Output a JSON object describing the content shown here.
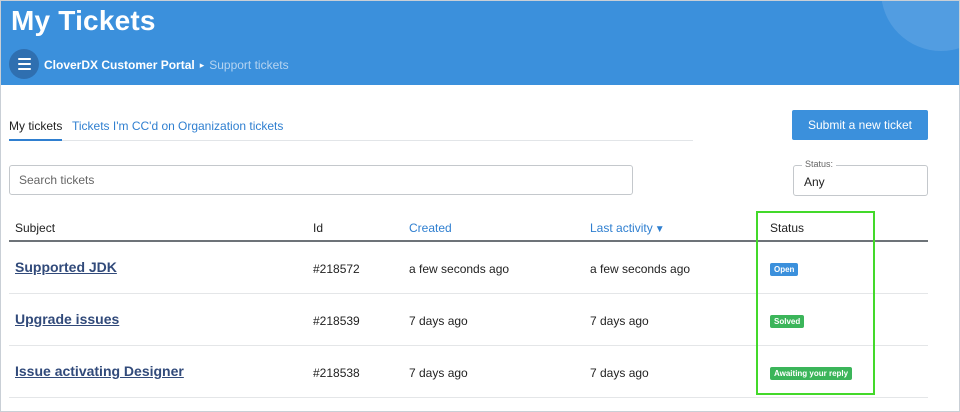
{
  "header": {
    "title": "My Tickets",
    "breadcrumb": {
      "root": "CloverDX Customer Portal",
      "separator": "▸",
      "current": "Support tickets"
    }
  },
  "tabs": [
    {
      "label": "My tickets",
      "active": true
    },
    {
      "label": "Tickets I'm CC'd on",
      "active": false
    },
    {
      "label": "Organization tickets",
      "active": false
    }
  ],
  "submit_button": "Submit a new ticket",
  "search": {
    "placeholder": "Search tickets",
    "value": ""
  },
  "status_filter": {
    "label": "Status:",
    "value": "Any"
  },
  "table": {
    "columns": {
      "subject": "Subject",
      "id": "Id",
      "created": "Created",
      "last_activity": "Last activity",
      "sort_indicator": "▼",
      "status": "Status"
    },
    "rows": [
      {
        "subject": "Supported JDK",
        "id": "#218572",
        "created": "a few seconds ago",
        "last_activity": "a few seconds ago",
        "status": "Open",
        "status_color": "#3b90dc"
      },
      {
        "subject": "Upgrade issues",
        "id": "#218539",
        "created": "7 days ago",
        "last_activity": "7 days ago",
        "status": "Solved",
        "status_color": "#3bb55a"
      },
      {
        "subject": "Issue activating Designer",
        "id": "#218538",
        "created": "7 days ago",
        "last_activity": "7 days ago",
        "status": "Awaiting your reply",
        "status_color": "#3bb55a"
      }
    ]
  },
  "colors": {
    "header_bg": "#3b90dc",
    "link": "#2f7fd0",
    "highlight": "#43d92a"
  }
}
